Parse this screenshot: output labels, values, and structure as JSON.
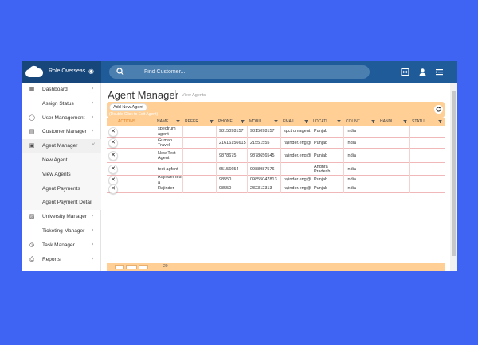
{
  "brand": {
    "name": "Role Overseas"
  },
  "search": {
    "placeholder": "Find Customer..."
  },
  "sidebar": {
    "items": [
      {
        "label": "Dashboard",
        "icon": "dashboard-icon",
        "chevron": ">"
      },
      {
        "label": "Assign Status",
        "icon": "",
        "chevron": ">"
      },
      {
        "label": "User Management",
        "icon": "user-icon",
        "chevron": ">"
      },
      {
        "label": "Customer Manager",
        "icon": "customer-icon",
        "chevron": ">"
      },
      {
        "label": "Agent Manager",
        "icon": "agent-icon",
        "chevron": "v"
      },
      {
        "label": "New Agent",
        "icon": "",
        "chevron": ""
      },
      {
        "label": "View Agents",
        "icon": "",
        "chevron": ""
      },
      {
        "label": "Agent Payments",
        "icon": "",
        "chevron": ""
      },
      {
        "label": "Agent Payment Detail",
        "icon": "",
        "chevron": ""
      },
      {
        "label": "University Manager",
        "icon": "university-icon",
        "chevron": ">"
      },
      {
        "label": "Ticketing Manager",
        "icon": "",
        "chevron": ">"
      },
      {
        "label": "Task Manager",
        "icon": "task-icon",
        "chevron": ">"
      },
      {
        "label": "Reports",
        "icon": "print-icon",
        "chevron": ">"
      }
    ]
  },
  "page": {
    "title": "Agent Manager",
    "breadcrumb": "View Agents -",
    "add_button": "Add New Agent",
    "add_hint": "(Double Click to Edit Agent)"
  },
  "table": {
    "columns": [
      "ACTIONS",
      "NAME",
      "REFER...",
      "PHONE...",
      "MOBIL...",
      "EMAIL ...",
      "LOCATI...",
      "COUNT...",
      "HANDL...",
      "STATU..."
    ],
    "rows": [
      [
        "spectrum agent",
        "",
        "9815098157",
        "9815098157",
        "spctrumagent...",
        "Punjab",
        "India",
        "",
        ""
      ],
      [
        "Guman Travel",
        "",
        "21616156615",
        "21551555",
        "rajinder.eng@...",
        "Punjab",
        "India",
        "",
        ""
      ],
      [
        "New Test Agent",
        "",
        "9878675",
        "9878656545",
        "rajinder.eng@...",
        "Punjab",
        "India",
        "",
        ""
      ],
      [
        "test agfent",
        "",
        "65156654",
        "9988987576",
        "",
        "Andhra Pradesh",
        "India",
        "",
        ""
      ],
      [
        "Rajinder test a",
        "",
        "98550",
        "09855047813",
        "rajinder.eng@...",
        "Punjab",
        "India",
        "",
        ""
      ],
      [
        "Rajinder",
        "",
        "98550",
        "232312313",
        "rajinder.eng@...",
        "Punjab",
        "India",
        "",
        ""
      ]
    ]
  },
  "footer": {
    "page_size": "20"
  },
  "colors": {
    "topbar": "#1f5a99",
    "header_band": "#ffcf95",
    "accent": "#e07e20",
    "background": "#3f63f2"
  }
}
